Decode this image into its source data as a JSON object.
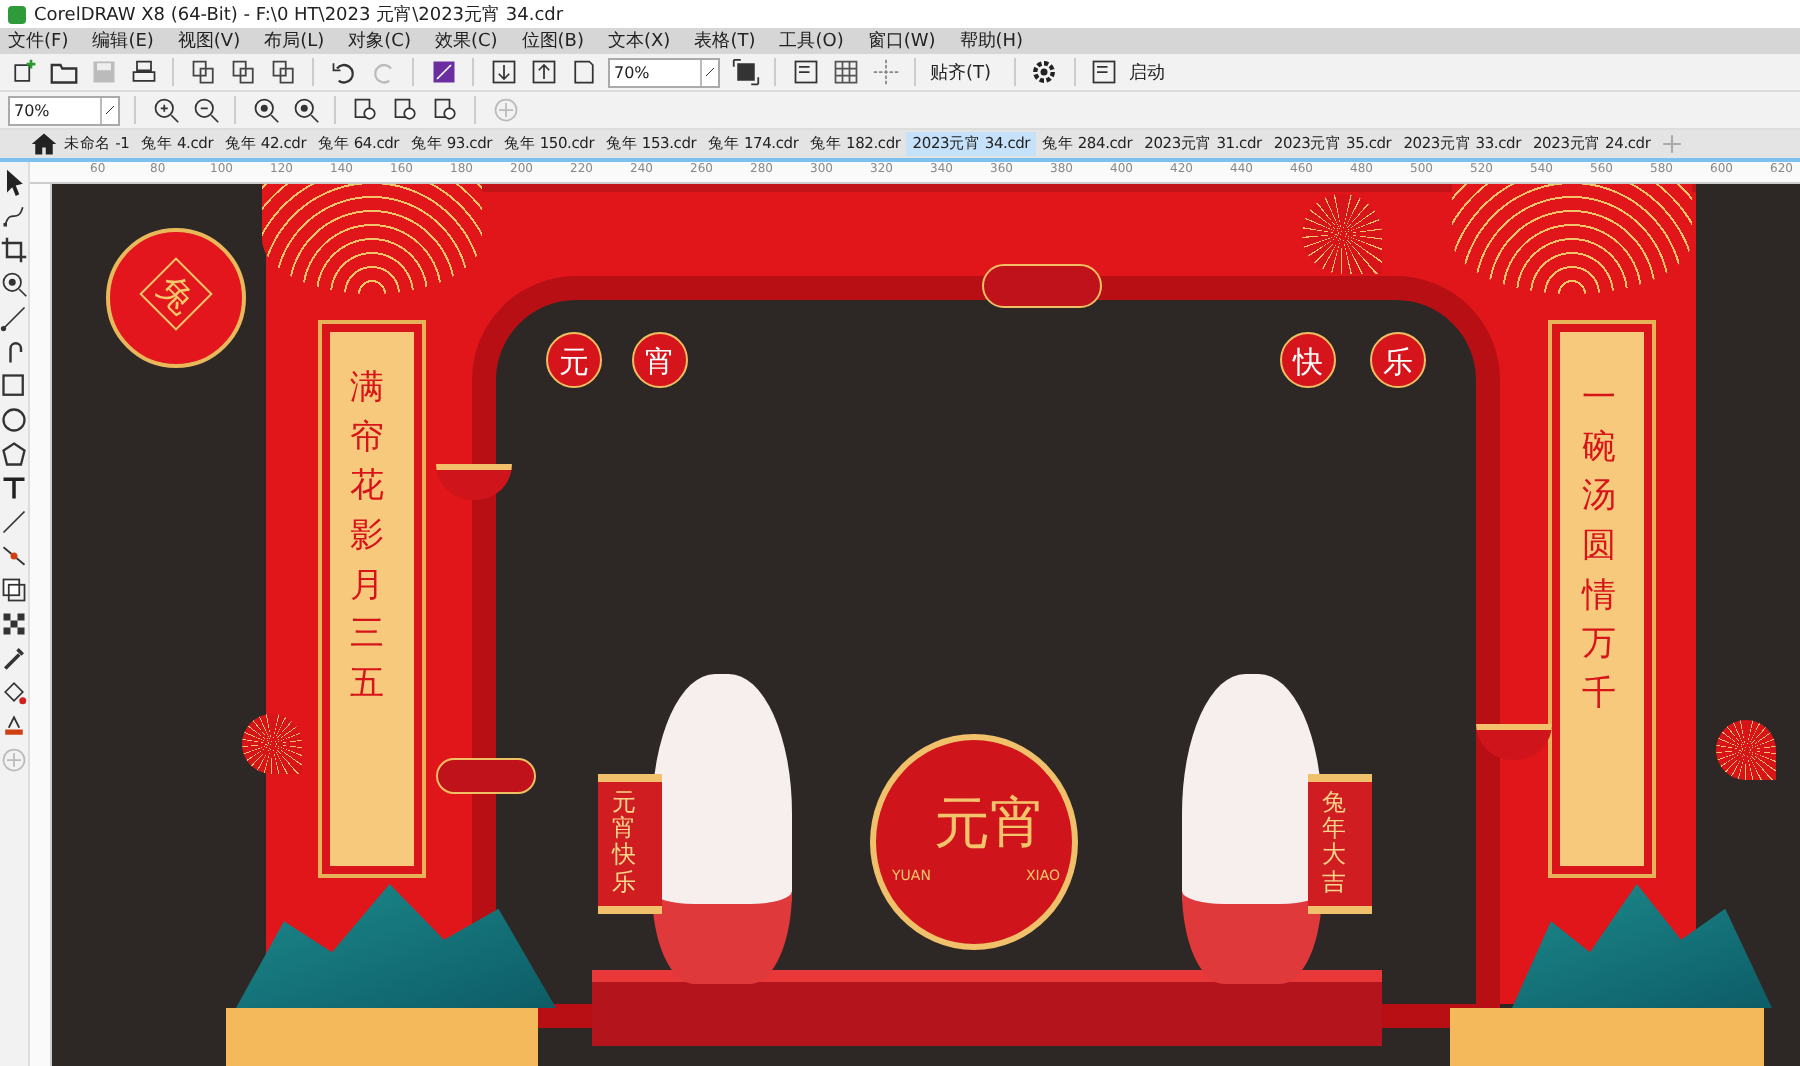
{
  "window": {
    "title": "CorelDRAW X8 (64-Bit) - F:\\0 HT\\2023 元宵\\2023元宵 34.cdr"
  },
  "menu": [
    "文件(F)",
    "编辑(E)",
    "视图(V)",
    "布局(L)",
    "对象(C)",
    "效果(C)",
    "位图(B)",
    "文本(X)",
    "表格(T)",
    "工具(O)",
    "窗口(W)",
    "帮助(H)"
  ],
  "toolbar": {
    "zoom": "70%",
    "snap": "贴齐(T)",
    "launch": "启动"
  },
  "property_bar": {
    "zoom": "70%"
  },
  "tabs": [
    {
      "label": "未命名 -1",
      "selected": false
    },
    {
      "label": "兔年 4.cdr",
      "selected": false
    },
    {
      "label": "兔年 42.cdr",
      "selected": false
    },
    {
      "label": "兔年 64.cdr",
      "selected": false
    },
    {
      "label": "兔年 93.cdr",
      "selected": false
    },
    {
      "label": "兔年 150.cdr",
      "selected": false
    },
    {
      "label": "兔年 153.cdr",
      "selected": false
    },
    {
      "label": "兔年 174.cdr",
      "selected": false
    },
    {
      "label": "兔年 182.cdr",
      "selected": false
    },
    {
      "label": "2023元宵 34.cdr",
      "selected": true
    },
    {
      "label": "兔年 284.cdr",
      "selected": false
    },
    {
      "label": "2023元宵 31.cdr",
      "selected": false
    },
    {
      "label": "2023元宵 35.cdr",
      "selected": false
    },
    {
      "label": "2023元宵 33.cdr",
      "selected": false
    },
    {
      "label": "2023元宵 24.cdr",
      "selected": false
    }
  ],
  "ruler": [
    "60",
    "80",
    "100",
    "120",
    "140",
    "160",
    "180",
    "200",
    "220",
    "240",
    "260",
    "280",
    "300",
    "320",
    "340",
    "360",
    "380",
    "400",
    "420",
    "440",
    "460",
    "480",
    "500",
    "520",
    "540",
    "560",
    "580",
    "600",
    "620"
  ],
  "artwork": {
    "big_lantern": "兔",
    "left_couplet": "满帘花影月三五",
    "right_couplet": "一碗汤圆情万千",
    "small_lanterns": [
      "元",
      "宵",
      "快",
      "乐"
    ],
    "center_title": "元宵",
    "center_left": "YUAN",
    "center_right": "XIAO",
    "left_scroll": "元宵快乐",
    "right_scroll": "兔年大吉"
  }
}
